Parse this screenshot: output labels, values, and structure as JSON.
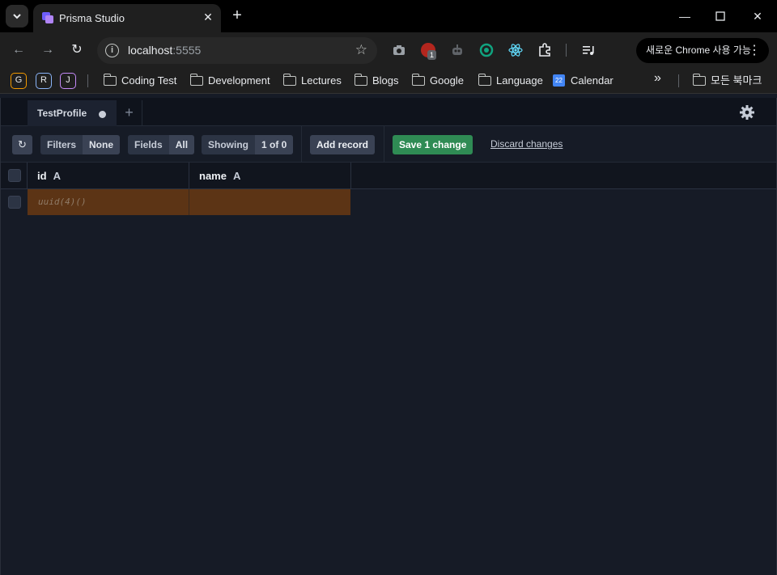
{
  "browser": {
    "tab_title": "Prisma Studio",
    "url_host": "localhost",
    "url_port": ":5555",
    "chrome_badge": "새로운 Chrome 사용 가능",
    "ext_badge_count": "1",
    "profiles": [
      "G",
      "R",
      "J"
    ],
    "bookmarks": [
      "Coding Test",
      "Development",
      "Lectures",
      "Blogs",
      "Google",
      "Language",
      "Calendar"
    ],
    "calendar_day": "22",
    "bookmarks_overflow": "»",
    "all_bookmarks": "모든 북마크"
  },
  "app": {
    "tab_label": "TestProfile",
    "filters": {
      "label": "Filters",
      "value": "None"
    },
    "fields": {
      "label": "Fields",
      "value": "All"
    },
    "showing": {
      "label": "Showing",
      "value": "1 of 0"
    },
    "add_record": "Add record",
    "save": "Save 1 change",
    "discard": "Discard changes",
    "columns": [
      {
        "name": "id",
        "type": "A"
      },
      {
        "name": "name",
        "type": "A"
      }
    ],
    "rows": [
      {
        "id": "uuid(4)()",
        "name": ""
      }
    ]
  },
  "colors": {
    "accent_save": "#2f8b54",
    "new_row": "#5c3415",
    "background": "#161b26"
  }
}
